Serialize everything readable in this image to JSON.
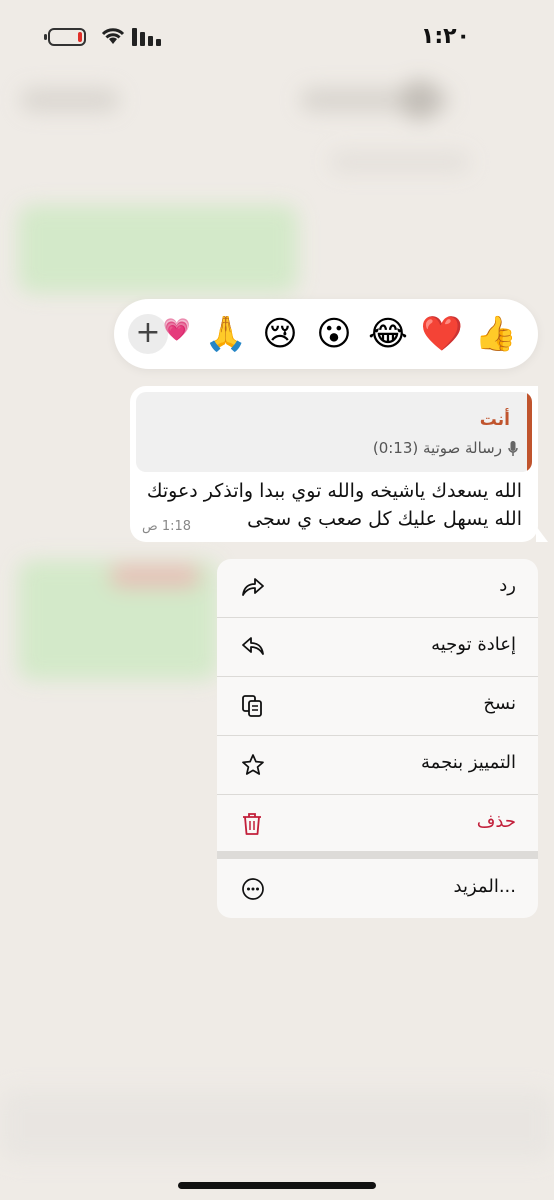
{
  "status_bar": {
    "time": "١:٢٠"
  },
  "reactions": {
    "emojis": [
      "👍",
      "❤️",
      "😂",
      "😮",
      "😢",
      "🙏"
    ],
    "extra_emoji": "💗",
    "add_label": "+"
  },
  "message": {
    "quote_author": "أنت",
    "quote_text": "رسالة صوتية (0:13)",
    "text_line1": "الله يسعدك ياشيخه والله توي ببدا واتذكر دعوتك",
    "text_line2": "الله يسهل عليك كل صعب ي سجى",
    "time": "1:18 ص"
  },
  "menu": {
    "reply": "رد",
    "forward": "إعادة توجيه",
    "copy": "نسخ",
    "star": "التمييز بنجمة",
    "delete": "حذف",
    "more": "المزيد..."
  },
  "colors": {
    "accent": "#c0542d",
    "danger": "#c21f3a",
    "background": "#efebe6"
  }
}
